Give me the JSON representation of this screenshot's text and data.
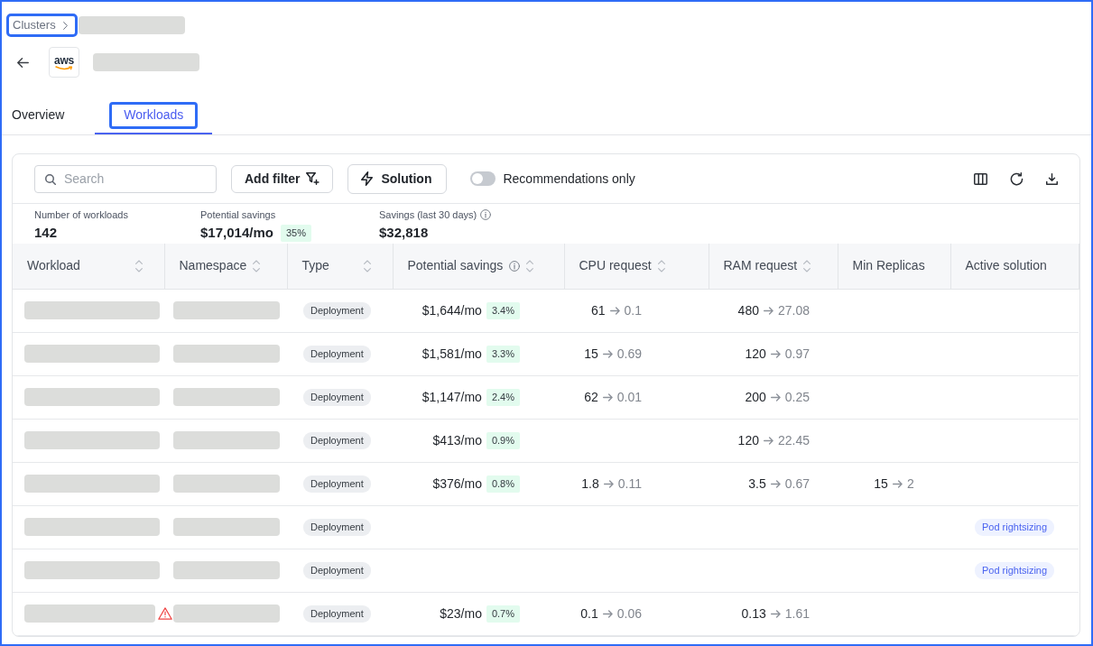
{
  "breadcrumb": {
    "label": "Clusters",
    "highlighted": true
  },
  "provider_logo": {
    "text": "aws"
  },
  "tabs": [
    {
      "label": "Overview",
      "selected": false,
      "highlighted": false
    },
    {
      "label": "Workloads",
      "selected": true,
      "highlighted": true
    }
  ],
  "toolbar": {
    "search": {
      "placeholder": "Search"
    },
    "buttons": [
      {
        "label": "Add filter",
        "kind": "filter"
      },
      {
        "label": "Solution",
        "kind": "solution"
      }
    ],
    "toggle": {
      "label": "Recommendations only",
      "on": false
    }
  },
  "summary": [
    {
      "label": "Number of workloads",
      "value": "142",
      "info": false
    },
    {
      "label": "Potential savings",
      "value": "$17,014/mo",
      "badge": "35%",
      "info": false
    },
    {
      "label": "Savings (last 30 days)",
      "value": "$32,818",
      "info": true
    }
  ],
  "table": {
    "columns": [
      {
        "label": "Workload",
        "sortable": true,
        "info": false
      },
      {
        "label": "Namespace",
        "sortable": true,
        "info": false
      },
      {
        "label": "Type",
        "sortable": true,
        "info": false
      },
      {
        "label": "Potential savings",
        "sortable": true,
        "info": true
      },
      {
        "label": "CPU request",
        "sortable": true,
        "info": false
      },
      {
        "label": "RAM request",
        "sortable": true,
        "info": false
      },
      {
        "label": "Min Replicas",
        "sortable": false,
        "info": false
      },
      {
        "label": "Active solution",
        "sortable": false,
        "info": false
      }
    ],
    "rows": [
      {
        "warning": false,
        "type": "Deployment",
        "savings": "$1,644/mo",
        "savings_pct": "3.4%",
        "cpu": {
          "from": "61",
          "to": "0.1"
        },
        "ram": {
          "from": "480",
          "to": "27.08"
        }
      },
      {
        "warning": false,
        "type": "Deployment",
        "savings": "$1,581/mo",
        "savings_pct": "3.3%",
        "cpu": {
          "from": "15",
          "to": "0.69"
        },
        "ram": {
          "from": "120",
          "to": "0.97"
        }
      },
      {
        "warning": false,
        "type": "Deployment",
        "savings": "$1,147/mo",
        "savings_pct": "2.4%",
        "cpu": {
          "from": "62",
          "to": "0.01"
        },
        "ram": {
          "from": "200",
          "to": "0.25"
        }
      },
      {
        "warning": false,
        "type": "Deployment",
        "savings": "$413/mo",
        "savings_pct": "0.9%",
        "ram": {
          "from": "120",
          "to": "22.45"
        }
      },
      {
        "warning": false,
        "type": "Deployment",
        "savings": "$376/mo",
        "savings_pct": "0.8%",
        "cpu": {
          "from": "1.8",
          "to": "0.11"
        },
        "ram": {
          "from": "3.5",
          "to": "0.67"
        },
        "min_replicas": {
          "from": "15",
          "to": "2"
        }
      },
      {
        "warning": false,
        "type": "Deployment",
        "solution": "Pod rightsizing"
      },
      {
        "warning": false,
        "type": "Deployment",
        "solution": "Pod rightsizing"
      },
      {
        "warning": true,
        "type": "Deployment",
        "savings": "$23/mo",
        "savings_pct": "0.7%",
        "cpu": {
          "from": "0.1",
          "to": "0.06"
        },
        "ram": {
          "from": "0.13",
          "to": "1.61"
        }
      }
    ]
  }
}
